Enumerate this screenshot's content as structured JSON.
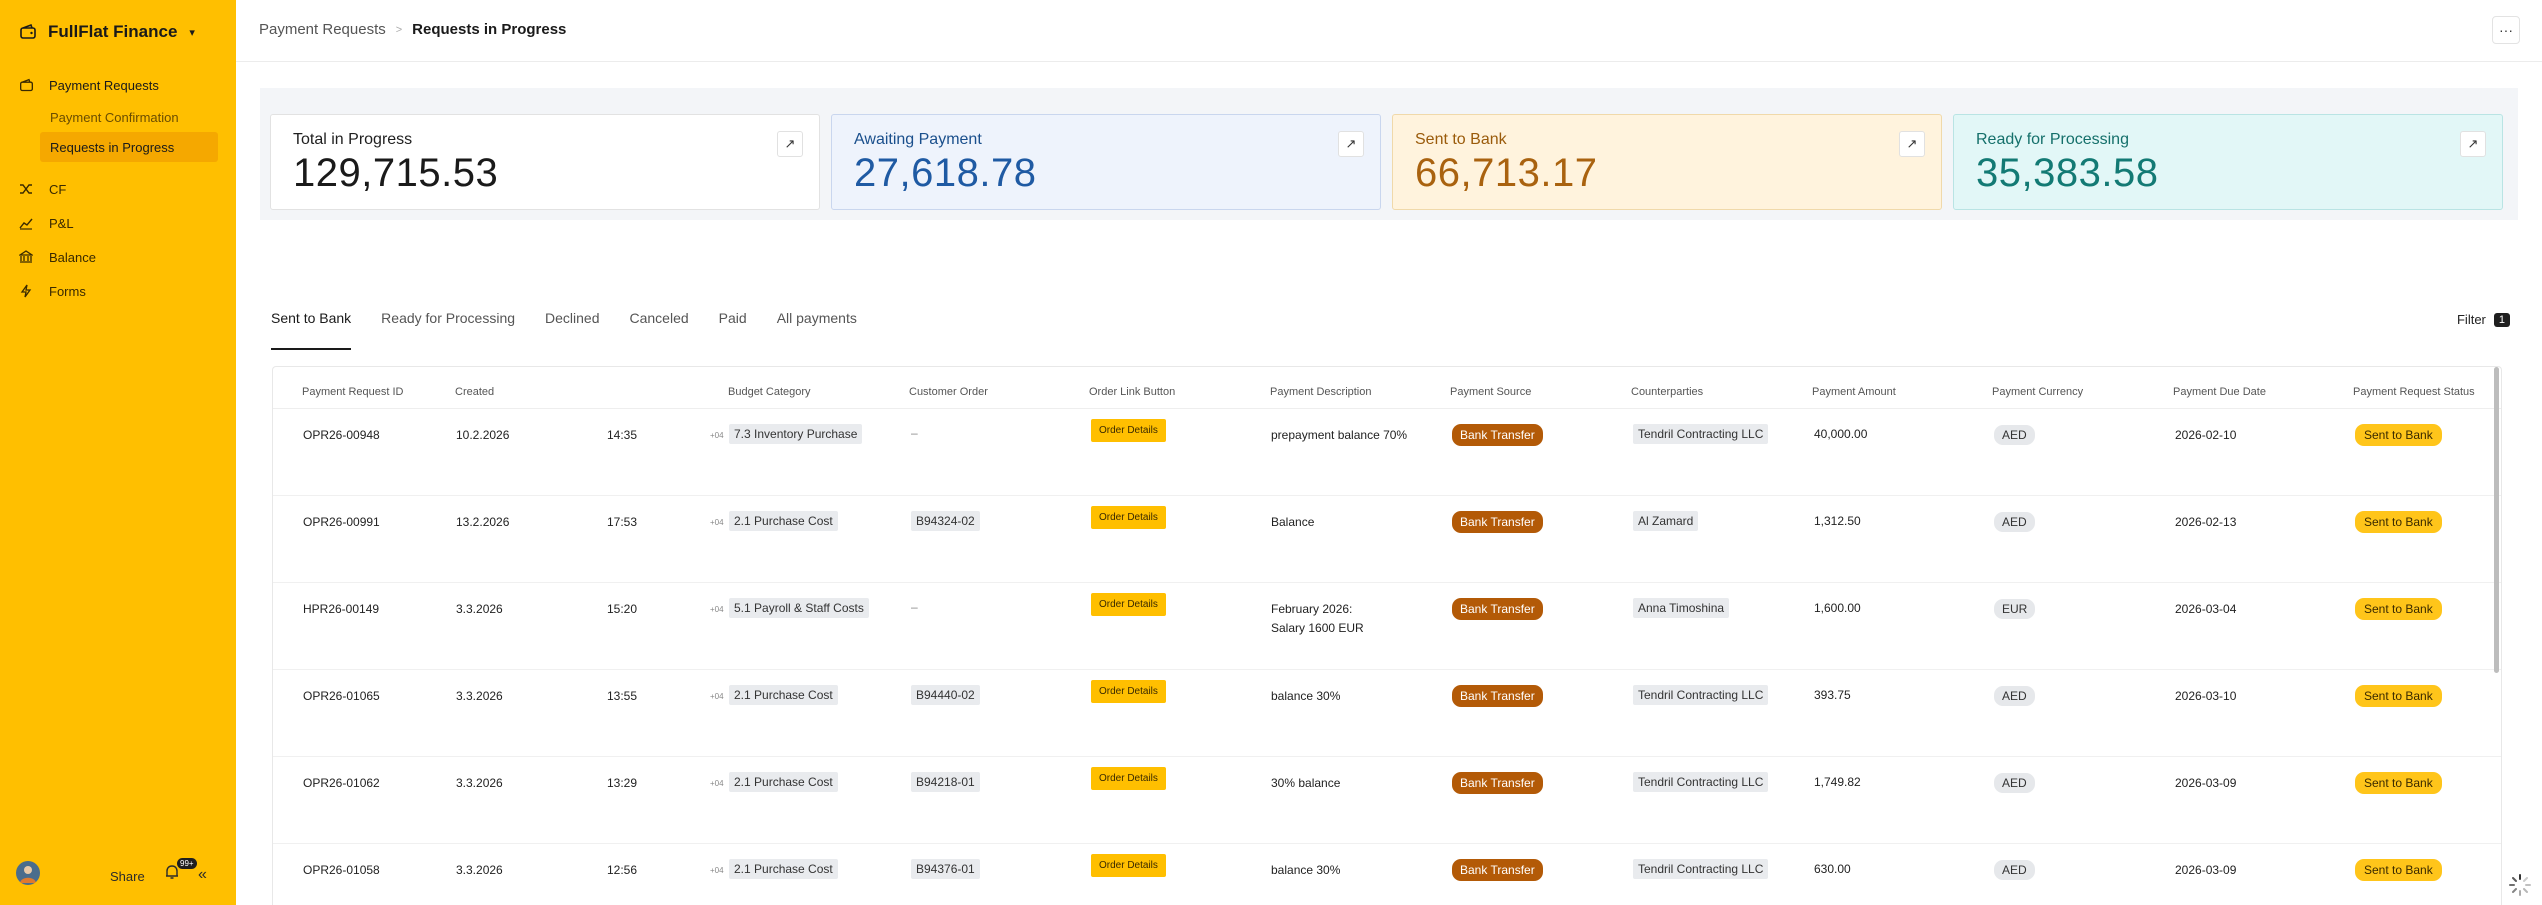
{
  "app": {
    "name": "FullFlat Finance"
  },
  "sidebar": {
    "payment_requests": "Payment Requests",
    "sub_items": [
      "Payment Confirmation",
      "Requests in Progress"
    ],
    "cf": "CF",
    "pnl": "P&L",
    "balance": "Balance",
    "forms": "Forms",
    "share": "Share",
    "notif_count": "99+"
  },
  "header": {
    "crumb_parent": "Payment Requests",
    "crumb_current": "Requests in Progress",
    "more": "···"
  },
  "kpis": [
    {
      "title": "Total in Progress",
      "value": "129,715.53",
      "bg": "#ffffff",
      "border": "#e2e2e2",
      "title_color": "#1f1f1f",
      "value_color": "#1a1a1a"
    },
    {
      "title": "Awaiting Payment",
      "value": "27,618.78",
      "bg": "#EEF3FC",
      "border": "#c9d6ee",
      "title_color": "#1a4f8c",
      "value_color": "#1f5aa3"
    },
    {
      "title": "Sent to Bank",
      "value": "66,713.17",
      "bg": "#FFF3DD",
      "border": "#f0d9aa",
      "title_color": "#9a5b0b",
      "value_color": "#A9620F"
    },
    {
      "title": "Ready for Processing",
      "value": "35,383.58",
      "bg": "#E2F7F7",
      "border": "#b9e4e4",
      "title_color": "#15706b",
      "value_color": "#137a74"
    }
  ],
  "tabs": [
    "Sent to Bank",
    "Ready for Processing",
    "Declined",
    "Canceled",
    "Paid",
    "All payments"
  ],
  "filter": {
    "label": "Filter",
    "count": "1"
  },
  "table": {
    "columns": [
      "Payment Request ID",
      "Created",
      "Budget Category",
      "Customer Order",
      "Order Link Button",
      "Payment Description",
      "Payment Source",
      "Counterparties",
      "Payment Amount",
      "Payment Currency",
      "Payment Due Date",
      "Payment Request Status"
    ],
    "rows": [
      {
        "id": "OPR26-00948",
        "date": "10.2.2026",
        "time": "14:35",
        "tz": "+04",
        "category": "7.3 Inventory Purchase",
        "order": "–",
        "order_tag": false,
        "link": "Order Details",
        "desc": "prepayment balance 70%",
        "desc2": "",
        "source": "Bank Transfer",
        "counterparty": "Tendril Contracting LLC",
        "amount": "40,000.00",
        "currency": "AED",
        "due": "2026-02-10",
        "status": "Sent to Bank"
      },
      {
        "id": "OPR26-00991",
        "date": "13.2.2026",
        "time": "17:53",
        "tz": "+04",
        "category": "2.1 Purchase Cost",
        "order": "B94324-02",
        "order_tag": true,
        "link": "Order Details",
        "desc": "Balance",
        "desc2": "",
        "source": "Bank Transfer",
        "counterparty": "Al Zamard",
        "amount": "1,312.50",
        "currency": "AED",
        "due": "2026-02-13",
        "status": "Sent to Bank"
      },
      {
        "id": "HPR26-00149",
        "date": "3.3.2026",
        "time": "15:20",
        "tz": "+04",
        "category": "5.1 Payroll & Staff Costs",
        "order": "–",
        "order_tag": false,
        "link": "Order Details",
        "desc": "February 2026:",
        "desc2": "Salary 1600 EUR",
        "source": "Bank Transfer",
        "counterparty": "Anna Timoshina",
        "amount": "1,600.00",
        "currency": "EUR",
        "due": "2026-03-04",
        "status": "Sent to Bank"
      },
      {
        "id": "OPR26-01065",
        "date": "3.3.2026",
        "time": "13:55",
        "tz": "+04",
        "category": "2.1 Purchase Cost",
        "order": "B94440-02",
        "order_tag": true,
        "link": "Order Details",
        "desc": "balance 30%",
        "desc2": "",
        "source": "Bank Transfer",
        "counterparty": "Tendril Contracting LLC",
        "amount": "393.75",
        "currency": "AED",
        "due": "2026-03-10",
        "status": "Sent to Bank"
      },
      {
        "id": "OPR26-01062",
        "date": "3.3.2026",
        "time": "13:29",
        "tz": "+04",
        "category": "2.1 Purchase Cost",
        "order": "B94218-01",
        "order_tag": true,
        "link": "Order Details",
        "desc": "30% balance",
        "desc2": "",
        "source": "Bank Transfer",
        "counterparty": "Tendril Contracting LLC",
        "amount": "1,749.82",
        "currency": "AED",
        "due": "2026-03-09",
        "status": "Sent to Bank"
      },
      {
        "id": "OPR26-01058",
        "date": "3.3.2026",
        "time": "12:56",
        "tz": "+04",
        "category": "2.1 Purchase Cost",
        "order": "B94376-01",
        "order_tag": true,
        "link": "Order Details",
        "desc": "balance 30%",
        "desc2": "",
        "source": "Bank Transfer",
        "counterparty": "Tendril Contracting LLC",
        "amount": "630.00",
        "currency": "AED",
        "due": "2026-03-09",
        "status": "Sent to Bank"
      }
    ]
  },
  "colors": {
    "sidebar": "#FFBF00",
    "accent": "#FFBF00",
    "source_pill": "#B35A07"
  }
}
